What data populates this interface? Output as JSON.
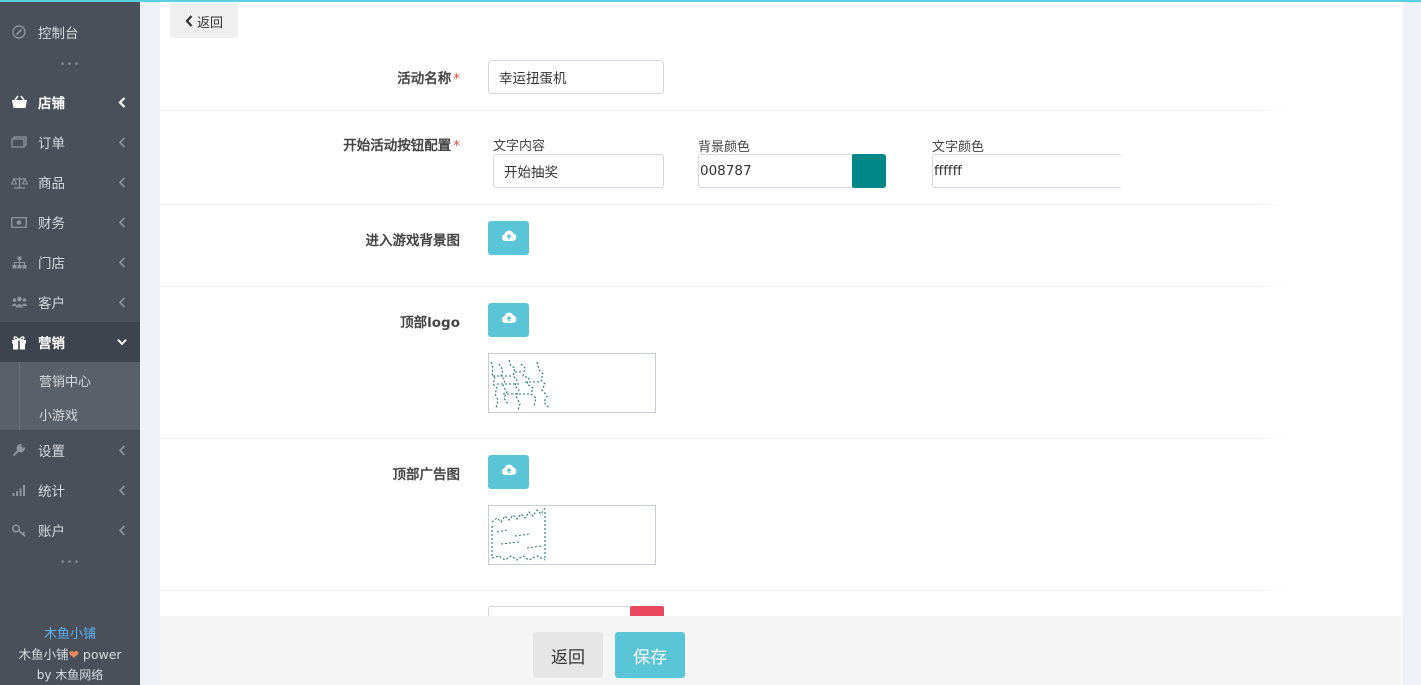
{
  "sidebar": {
    "items": [
      {
        "label": "控制台",
        "icon": "dashboard-icon"
      },
      {
        "label": "店铺",
        "icon": "shop-basket-icon"
      },
      {
        "label": "订单",
        "icon": "order-icon"
      },
      {
        "label": "商品",
        "icon": "scale-icon"
      },
      {
        "label": "财务",
        "icon": "money-icon"
      },
      {
        "label": "门店",
        "icon": "sitemap-icon"
      },
      {
        "label": "客户",
        "icon": "users-icon"
      },
      {
        "label": "营销",
        "icon": "gift-icon"
      },
      {
        "label": "设置",
        "icon": "wrench-icon"
      },
      {
        "label": "统计",
        "icon": "signal-bars-icon"
      },
      {
        "label": "账户",
        "icon": "key-icon"
      }
    ],
    "dots": "•••",
    "submenu": [
      "营销中心",
      "小游戏"
    ],
    "brand": {
      "name": "木鱼小铺",
      "line2_a": "木鱼小铺",
      "line2_b": "power",
      "line3": "by 木鱼网络"
    }
  },
  "form": {
    "back_label": "返回",
    "activity_name_label": "活动名称",
    "activity_name_value": "幸运扭蛋机",
    "button_config_label": "开始活动按钮配置",
    "text_content_label": "文字内容",
    "text_content_value": "开始抽奖",
    "bg_color_label": "背景颜色",
    "bg_color_value": "008787",
    "text_color_label": "文字颜色",
    "text_color_value": "ffffff",
    "game_bg_label": "进入游戏背景图",
    "top_logo_label": "顶部logo",
    "top_ad_label": "顶部广告图",
    "required_mark": "*"
  },
  "footer": {
    "back_label": "返回",
    "save_label": "保存"
  },
  "colors": {
    "accent": "#5bc5d8",
    "sidebar_bg": "#49505a",
    "swatch": "#008787",
    "required": "#e74c3c"
  }
}
